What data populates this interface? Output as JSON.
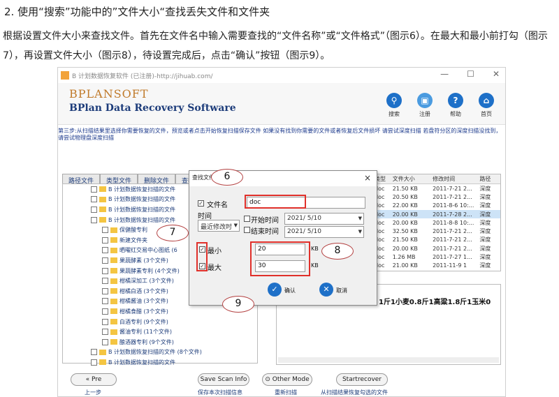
{
  "article": {
    "heading": "2. 使用“搜索”功能中的”文件大小“查找丢失文件和文件夹",
    "paragraph": "根据设置文件大小来查找文件。首先在文件名中输入需要查找的“文件名称”或“文件格式”（图示6）。在最大和最小前打勾（图示7），再设置文件大小（图示8），待设置完成后，点击“确认”按钮（图示9）。"
  },
  "app": {
    "title": "B 计划数据恢复软件 (已注册)-http://jihuab.com/",
    "logo_top": "BPLANSOFT",
    "logo_bottom": "BPlan Data Recovery Software",
    "tools": [
      {
        "icon": "search-icon",
        "label": "搜索"
      },
      {
        "icon": "register-icon",
        "label": "注册"
      },
      {
        "icon": "help-icon",
        "label": "帮助"
      },
      {
        "icon": "home-icon",
        "label": "首页"
      }
    ],
    "note": "第三步:从扫描结果里选择你需要恢复的文件，预览或者点击开始恢复扫描保存文件 如果没有找到你需要的文件或者恢复后文件损坏 请尝试深度扫描 若盘符分区的深度扫描没找到，请尝试物理盘深度扫描",
    "tabs": [
      "路径文件",
      "类型文件",
      "删除文件",
      "查找文件"
    ],
    "tree": [
      "B 计划数据恢复扫描的文件",
      "B 计划数据恢复扫描的文件",
      "B 计划数据恢复扫描的文件",
      "B 计划数据恢复扫描的文件",
      "保健酸专利",
      "新建文件夹",
      "晒曜红交易中心图纸 (6",
      "果蔬酵素 (3个文件)",
      "果蔬酵素专利 (4个文件)",
      "柑橘深加工 (3个文件)",
      "柑橘白酒 (3个文件)",
      "柑橘酱油 (3个文件)",
      "柑橘食醋 (3个文件)",
      "白酒专利 (9个文件)",
      "酱油专利 (11个文件)",
      "酿酒器专利 (9个文件)",
      "B 计划数据恢复扫描的文件 (8个文件)",
      "B 计划数据恢复扫描的文件"
    ],
    "table_headers": [
      "类型",
      "文件大小",
      "修改时间",
      "路径"
    ],
    "table_rows": [
      [
        "doc",
        "21.50 KB",
        "2011-7-21 2...",
        "深度"
      ],
      [
        "doc",
        "20.50 KB",
        "2011-7-21 2...",
        "深度"
      ],
      [
        "doc",
        "22.00 KB",
        "2011-8-6 10:...",
        "深度"
      ],
      [
        "doc",
        "20.00 KB",
        "2011-7-28 2...",
        "深度"
      ],
      [
        "doc",
        "20.00 KB",
        "2011-8-8 10:...",
        "深度"
      ],
      [
        "doc",
        "32.50 KB",
        "2011-7-21 2...",
        "深度"
      ],
      [
        "doc",
        "21.50 KB",
        "2011-7-21 2...",
        "深度"
      ],
      [
        "doc",
        "20.00 KB",
        "2011-7-21 2...",
        "深度"
      ],
      [
        "doc",
        "1.26 MB",
        "2011-7-27 1...",
        "深度"
      ],
      [
        "doc",
        "21.00 KB",
        "2011-11-9 1",
        "深度"
      ]
    ],
    "preview_text": "1斤1小麦0.8斤1高粱1.8斤1玉米0",
    "bottom": {
      "pre": "Pre",
      "pre_caption": "上一步",
      "save": "Save Scan Info",
      "save_caption": "保存本次扫描信息",
      "other": "Other Mode",
      "other_caption": "重新扫描",
      "start": "Startrecover",
      "start_caption": "从扫描结果恢复勾选的文件"
    }
  },
  "dialog": {
    "title": "查找文件",
    "close": "×",
    "filename_label": "文件名",
    "filename_value": "doc",
    "time_label": "时间",
    "time_select": "最近修改时",
    "start_time_label": "开始时间",
    "end_time_label": "结束时间",
    "start_date": "2021/ 5/10",
    "end_date": "2021/ 5/10",
    "min_label": "最小",
    "max_label": "最大",
    "min_value": "20",
    "max_value": "30",
    "unit": "KB",
    "ok": "确认",
    "cancel": "取消"
  },
  "callouts": [
    "6",
    "7",
    "8",
    "9"
  ]
}
